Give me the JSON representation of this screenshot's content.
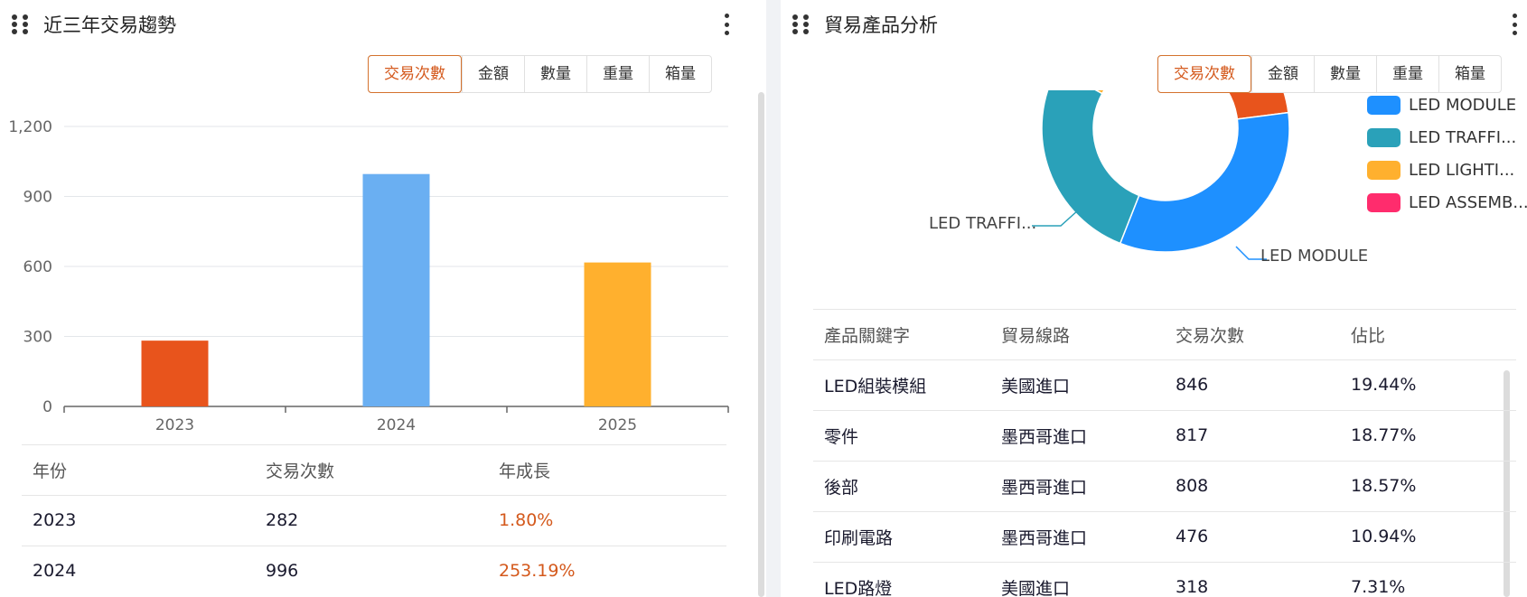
{
  "left_panel": {
    "title": "近三年交易趨勢",
    "tabs": [
      "交易次數",
      "金額",
      "數量",
      "重量",
      "箱量"
    ],
    "active_tab": 0,
    "table": {
      "headers": [
        "年份",
        "交易次數",
        "年成長"
      ],
      "rows": [
        [
          "2023",
          "282",
          "1.80%"
        ],
        [
          "2024",
          "996",
          "253.19%"
        ]
      ]
    }
  },
  "right_panel": {
    "title": "貿易產品分析",
    "tabs": [
      "交易次數",
      "金額",
      "數量",
      "重量",
      "箱量"
    ],
    "active_tab": 0,
    "legend": [
      {
        "label": "LED MODULE",
        "color": "#1e90ff"
      },
      {
        "label": "LED TRAFFI...",
        "color": "#2aa1b9"
      },
      {
        "label": "LED LIGHTI...",
        "color": "#ffb02e"
      },
      {
        "label": "LED ASSEMB...",
        "color": "#ff2c6d"
      }
    ],
    "donut_labels": [
      "LED TRAFFI...",
      "LED MODULE"
    ],
    "table": {
      "headers": [
        "產品關鍵字",
        "貿易線路",
        "交易次數",
        "佔比"
      ],
      "rows": [
        [
          "LED組裝模組",
          "美國進口",
          "846",
          "19.44%"
        ],
        [
          "零件",
          "墨西哥進口",
          "817",
          "18.77%"
        ],
        [
          "後部",
          "墨西哥進口",
          "808",
          "18.57%"
        ],
        [
          "印刷電路",
          "墨西哥進口",
          "476",
          "10.94%"
        ],
        [
          "LED路燈",
          "美國進口",
          "318",
          "7.31%"
        ]
      ]
    }
  },
  "chart_data": [
    {
      "type": "bar",
      "categories": [
        "2023",
        "2024",
        "2025"
      ],
      "values": [
        282,
        996,
        617
      ],
      "colors": [
        "#e8541c",
        "#6aaff2",
        "#ffb02e"
      ],
      "yticks": [
        "0",
        "300",
        "600",
        "900",
        "1,200"
      ],
      "ylim": [
        0,
        1200
      ],
      "grid": true
    },
    {
      "type": "pie",
      "categories": [
        "LED MODULE",
        "LED TRAFFI...",
        "LED LIGHTI...",
        "LED ASSEMB..."
      ],
      "values": [
        31,
        27,
        22,
        20
      ],
      "colors": [
        "#1e90ff",
        "#2aa1b9",
        "#ffb02e",
        "#e8541c"
      ]
    }
  ]
}
